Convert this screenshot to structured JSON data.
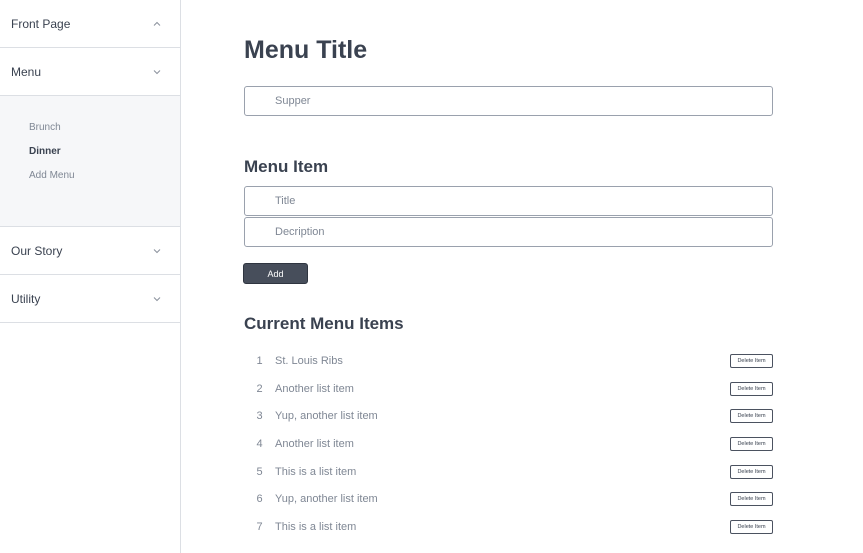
{
  "sidebar": {
    "sections": [
      {
        "label": "Front Page",
        "expanded": true
      },
      {
        "label": "Menu",
        "expanded": true
      },
      {
        "label": "Our Story",
        "expanded": false
      },
      {
        "label": "Utility",
        "expanded": false
      }
    ],
    "menu_items": [
      {
        "label": "Brunch",
        "active": false
      },
      {
        "label": "Dinner",
        "active": true
      },
      {
        "label": "Add Menu",
        "active": false
      }
    ]
  },
  "main": {
    "title": "Menu Title",
    "title_input": {
      "value": "",
      "placeholder": "Supper"
    },
    "item_heading": "Menu Item",
    "item_title_input": {
      "value": "",
      "placeholder": "Title"
    },
    "item_description_input": {
      "value": "",
      "placeholder": "Decription"
    },
    "add_label": "Add",
    "current_heading": "Current Menu Items",
    "delete_label": "Delete Item",
    "items": [
      {
        "num": "1",
        "text": "St. Louis Ribs"
      },
      {
        "num": "2",
        "text": "Another list item"
      },
      {
        "num": "3",
        "text": "Yup, another list item"
      },
      {
        "num": "4",
        "text": "Another list item"
      },
      {
        "num": "5",
        "text": "This is a list item"
      },
      {
        "num": "6",
        "text": "Yup, another list item"
      },
      {
        "num": "7",
        "text": "This is a list item"
      }
    ]
  },
  "colors": {
    "text": "#3a4250",
    "muted": "#7f8794",
    "button": "#474e5b",
    "border": "#dcdfe4"
  },
  "icons": {
    "collapse": "chevron-up-icon",
    "expand": "chevron-down-icon"
  }
}
